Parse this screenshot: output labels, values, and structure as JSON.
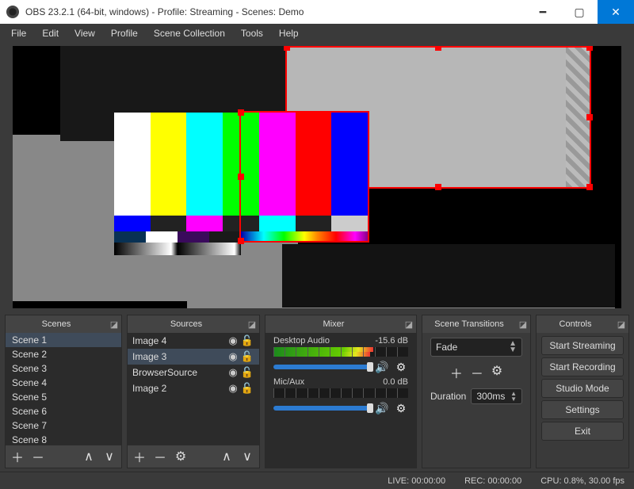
{
  "titlebar": {
    "title": "OBS 23.2.1 (64-bit, windows) - Profile: Streaming - Scenes: Demo"
  },
  "menubar": [
    "File",
    "Edit",
    "View",
    "Profile",
    "Scene Collection",
    "Tools",
    "Help"
  ],
  "scenes": {
    "title": "Scenes",
    "items": [
      "Scene 1",
      "Scene 2",
      "Scene 3",
      "Scene 4",
      "Scene 5",
      "Scene 6",
      "Scene 7",
      "Scene 8"
    ],
    "selected": 0
  },
  "sources": {
    "title": "Sources",
    "items": [
      {
        "name": "Image 4",
        "visible": true,
        "locked": false
      },
      {
        "name": "Image 3",
        "visible": true,
        "locked": false
      },
      {
        "name": "BrowserSource",
        "visible": true,
        "locked": false
      },
      {
        "name": "Image 2",
        "visible": true,
        "locked": false
      }
    ],
    "selected": 1
  },
  "mixer": {
    "title": "Mixer",
    "channels": [
      {
        "name": "Desktop Audio",
        "level_db": "-15.6 dB",
        "fill_pct": 74,
        "vol_pct": 100
      },
      {
        "name": "Mic/Aux",
        "level_db": "0.0 dB",
        "fill_pct": 0,
        "vol_pct": 100
      }
    ]
  },
  "transitions": {
    "title": "Scene Transitions",
    "selected": "Fade",
    "duration_label": "Duration",
    "duration_value": "300ms"
  },
  "controls": {
    "title": "Controls",
    "buttons": [
      "Start Streaming",
      "Start Recording",
      "Studio Mode",
      "Settings",
      "Exit"
    ]
  },
  "statusbar": {
    "live": "LIVE: 00:00:00",
    "rec": "REC: 00:00:00",
    "cpu": "CPU: 0.8%, 30.00 fps"
  }
}
